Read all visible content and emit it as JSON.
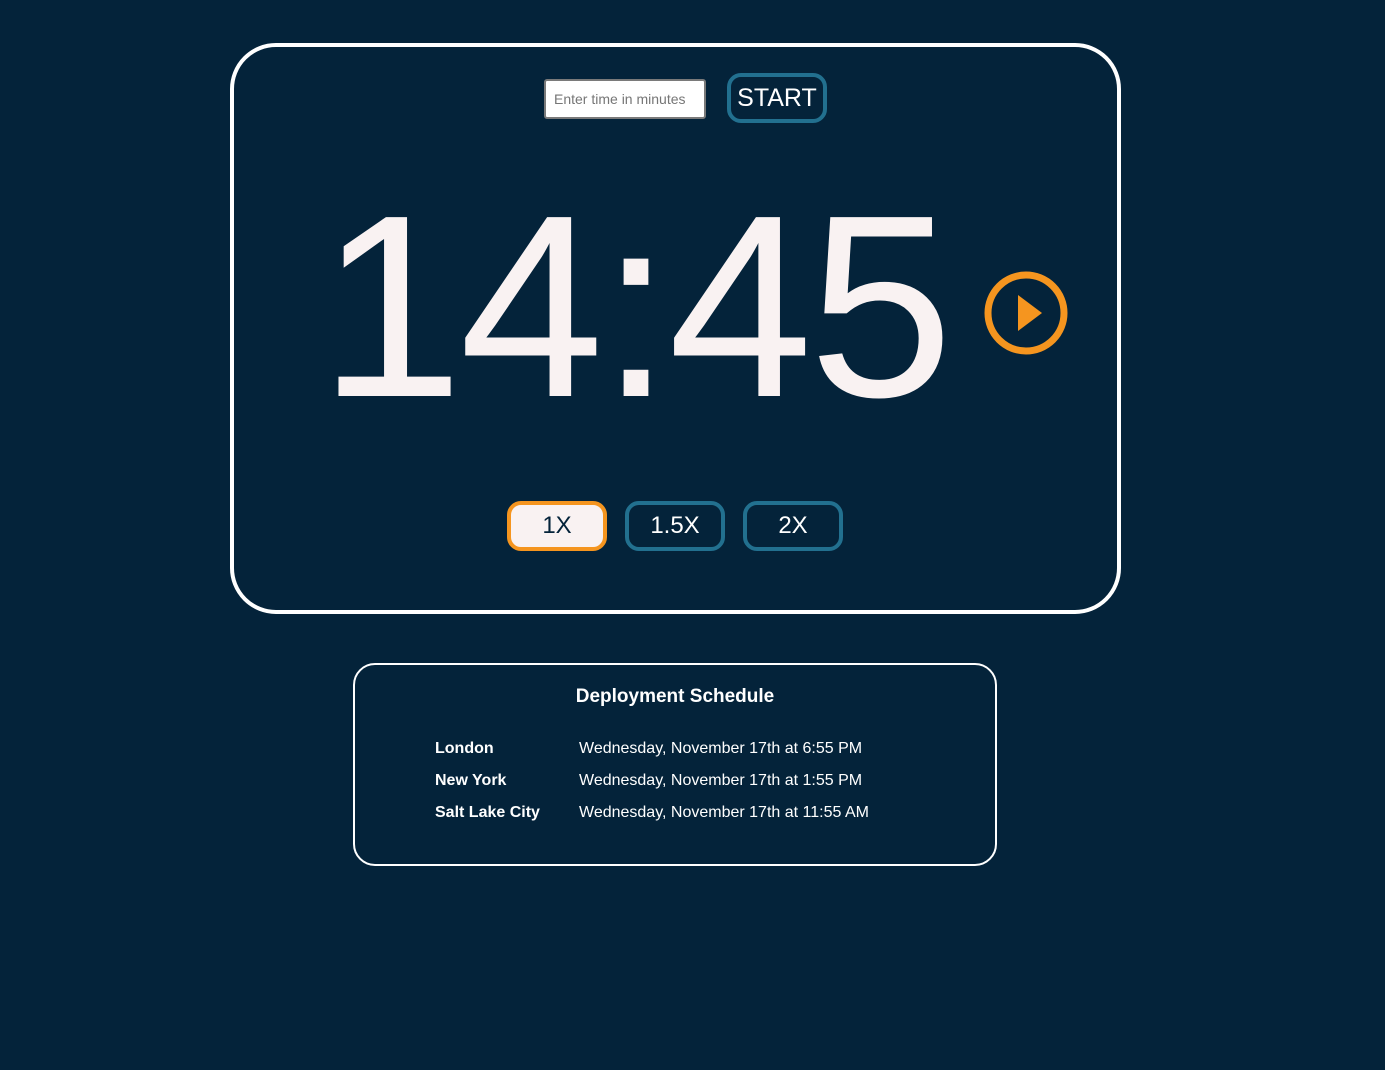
{
  "timer": {
    "input_placeholder": "Enter time in minutes",
    "input_value": "",
    "start_label": "START",
    "display": "14:45",
    "play_icon": "play-circle-icon",
    "speeds": [
      {
        "label": "1X",
        "active": true
      },
      {
        "label": "1.5X",
        "active": false
      },
      {
        "label": "2X",
        "active": false
      }
    ]
  },
  "schedule": {
    "title": "Deployment Schedule",
    "rows": [
      {
        "city": "London",
        "time": "Wednesday, November 17th at 6:55 PM"
      },
      {
        "city": "New York",
        "time": "Wednesday, November 17th at 1:55 PM"
      },
      {
        "city": "Salt Lake City",
        "time": "Wednesday, November 17th at 11:55 AM"
      }
    ]
  },
  "colors": {
    "background": "#04233a",
    "accent_orange": "#f5951f",
    "accent_teal": "#22708f",
    "text_light": "#f9f2f2",
    "border_white": "#ffffff"
  }
}
